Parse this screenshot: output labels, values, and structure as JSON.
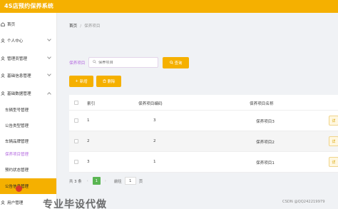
{
  "app": {
    "title": "4S店预约保养系统"
  },
  "sidebar": {
    "items": [
      {
        "label": "首页",
        "icon": "home-icon",
        "has_arrow": false
      },
      {
        "label": "个人中心",
        "icon": "user-icon",
        "has_arrow": true
      },
      {
        "label": "管理员管理",
        "icon": "user-icon",
        "has_arrow": true
      },
      {
        "label": "基础信息管理",
        "icon": "user-icon",
        "has_arrow": true
      },
      {
        "label": "基础数据管理",
        "icon": "user-icon",
        "has_arrow": true
      }
    ],
    "sub_items": [
      {
        "label": "车辆型号管理"
      },
      {
        "label": "公告类型管理"
      },
      {
        "label": "车辆品牌管理"
      },
      {
        "label": "保养项目管理"
      },
      {
        "label": "预约状态管理"
      },
      {
        "label": "公告信息管理"
      },
      {
        "label": "用户管理"
      }
    ]
  },
  "breadcrumb": {
    "home": "首页",
    "separator": "/",
    "current": "保养项目"
  },
  "search": {
    "label": "保养项目",
    "placeholder": "保养项目",
    "button": "查询"
  },
  "actions": {
    "add": "新增",
    "delete": "删除",
    "add_icon": "plus-icon",
    "delete_icon": "trash-icon"
  },
  "table": {
    "columns": [
      "索引",
      "保养项目编码",
      "保养项目名称"
    ],
    "rows": [
      {
        "index": "1",
        "code": "3",
        "name": "保养项目3",
        "action": "详"
      },
      {
        "index": "2",
        "code": "2",
        "name": "保养项目2",
        "action": "详"
      },
      {
        "index": "3",
        "code": "1",
        "name": "保养项目1",
        "action": "详"
      }
    ]
  },
  "pagination": {
    "total_text": "共 3 条",
    "current_page": "1",
    "goto_label": "前往",
    "goto_value": "1",
    "page_suffix": "页"
  },
  "overlay": {
    "watermark": "专业毕设代做",
    "csdn": "CSDN @QQ242219979"
  },
  "colors": {
    "accent": "#f5b000",
    "highlight_text": "#b56be0"
  }
}
